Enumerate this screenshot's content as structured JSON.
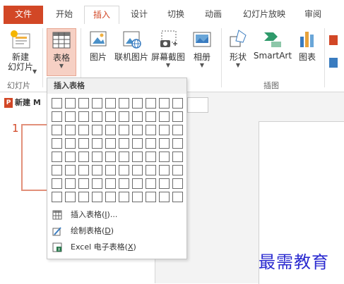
{
  "tabs": {
    "file": "文件",
    "home": "开始",
    "insert": "插入",
    "design": "设计",
    "transitions": "切换",
    "animations": "动画",
    "slideshow": "幻灯片放映",
    "review": "审阅"
  },
  "ribbon": {
    "new_slide_line1": "新建",
    "new_slide_line2": "幻灯片",
    "table": "表格",
    "picture": "图片",
    "online_picture": "联机图片",
    "screenshot": "屏幕截图",
    "album": "相册",
    "shapes": "形状",
    "smartart": "SmartArt",
    "chart": "图表",
    "group_slides": "幻灯片",
    "group_illustrations": "插图"
  },
  "dropdown": {
    "header": "插入表格",
    "grid_rows": 8,
    "grid_cols": 10,
    "insert_table_text": "插入表格(",
    "insert_table_key": "I",
    "insert_table_tail": ")...",
    "draw_table_text": "绘制表格(",
    "draw_table_key": "D",
    "draw_table_tail": ")",
    "excel_text": "Excel 电子表格(",
    "excel_key": "X",
    "excel_tail": ")"
  },
  "document": {
    "tab_label": "新建 M",
    "slide_number": "1"
  },
  "watermark": "最需教育",
  "colors": {
    "accent": "#d24726",
    "pressed_bg": "#f6d0c4",
    "watermark": "#2b2bd0"
  },
  "icons": [
    "new-slide-icon",
    "table-icon",
    "picture-icon",
    "online-picture-icon",
    "screenshot-icon",
    "album-icon",
    "shapes-icon",
    "smartart-icon",
    "chart-icon",
    "insert-table-icon",
    "draw-table-icon",
    "excel-icon"
  ]
}
